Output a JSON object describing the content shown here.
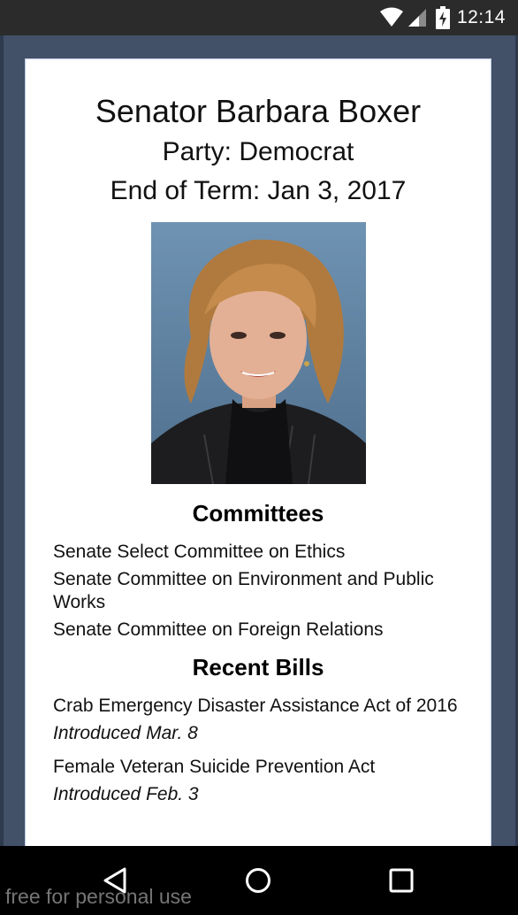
{
  "status_bar": {
    "time": "12:14"
  },
  "senator": {
    "name": "Senator Barbara Boxer",
    "party": "Party: Democrat",
    "end_of_term": "End of Term: Jan 3, 2017"
  },
  "committees": {
    "heading": "Committees",
    "items": [
      "Senate Select Committee on Ethics",
      "Senate Committee on Environment and Public Works",
      "Senate Committee on Foreign Relations"
    ]
  },
  "recent_bills": {
    "heading": "Recent Bills",
    "items": [
      {
        "title": "Crab Emergency Disaster Assistance Act of 2016",
        "date": "Introduced Mar. 8"
      },
      {
        "title": "Female Veteran Suicide Prevention Act",
        "date": "Introduced Feb. 3"
      }
    ]
  },
  "nav_icons": [
    "back-icon",
    "home-icon",
    "recents-icon"
  ],
  "watermark": "free for personal use"
}
